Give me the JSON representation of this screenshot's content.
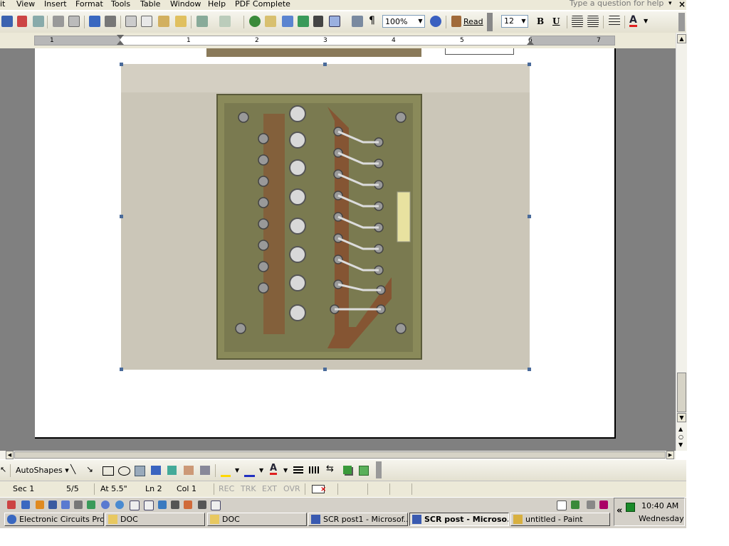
{
  "menu": {
    "items": [
      "it",
      "View",
      "Insert",
      "Format",
      "Tools",
      "Table",
      "Window",
      "Help",
      "PDF Complete"
    ],
    "help_placeholder": "Type a question for help"
  },
  "toolbar": {
    "zoom": "100%",
    "read_label": "Read",
    "font_size": "12",
    "bold": "B",
    "underline": "U",
    "pilcrow": "¶",
    "font_color_letter": "A"
  },
  "ruler": {
    "numbers": [
      "1",
      "1",
      "2",
      "3",
      "4",
      "5",
      "6",
      "7"
    ]
  },
  "drawing_toolbar": {
    "autoshapes_label": "AutoShapes"
  },
  "status": {
    "section": "Sec 1",
    "page": "5/5",
    "at": "At 5.5\"",
    "line": "Ln 2",
    "col": "Col 1",
    "rec": "REC",
    "trk": "TRK",
    "ext": "EXT",
    "ovr": "OVR"
  },
  "taskbar": {
    "buttons": [
      {
        "label": "Electronic Circuits Pro...",
        "icon": "internet-explorer-icon",
        "active": false
      },
      {
        "label": "DOC",
        "icon": "folder-icon",
        "active": false
      },
      {
        "label": "DOC",
        "icon": "folder-icon",
        "active": false
      },
      {
        "label": "SCR post1 - Microsof...",
        "icon": "word-icon",
        "active": false
      },
      {
        "label": "SCR post - Microso...",
        "icon": "word-icon",
        "active": true
      },
      {
        "label": "untitled - Paint",
        "icon": "paint-icon",
        "active": false
      }
    ],
    "clock_time": "10:40 AM",
    "clock_day": "Wednesday",
    "tray_chevron": "«"
  },
  "colors": {
    "workspace_gray": "#808080",
    "toolbar_face": "#ece9d8",
    "selection_handle": "#4a6b9a",
    "font_color_red": "#e02020"
  }
}
